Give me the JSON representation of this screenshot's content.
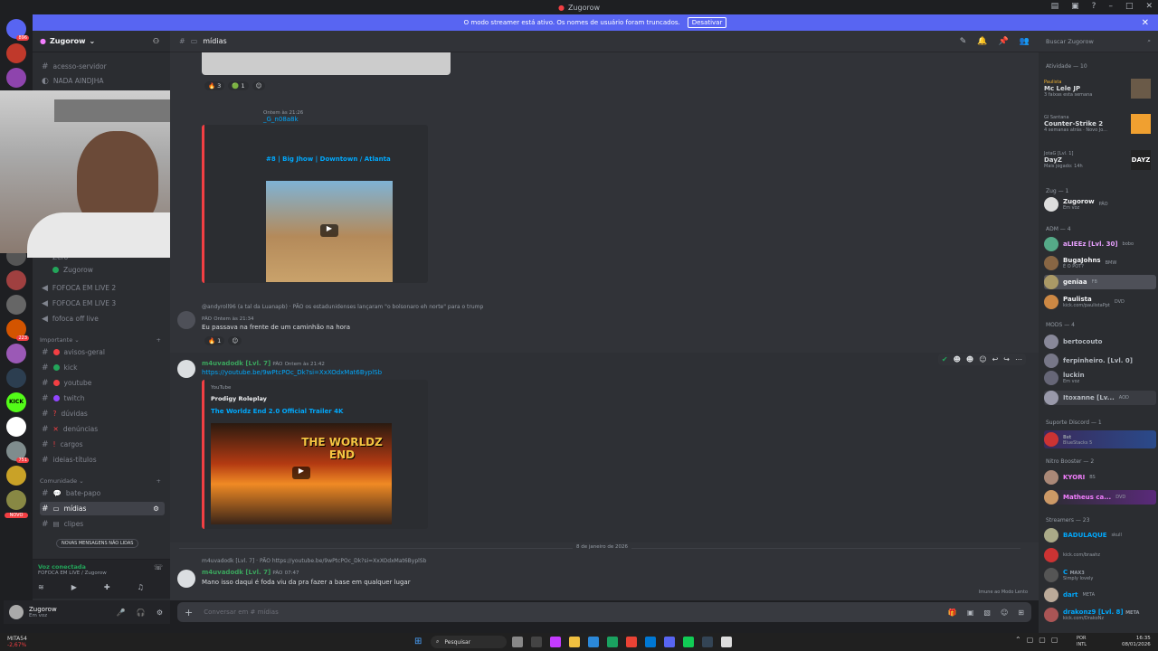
{
  "window": {
    "title": "Zugorow"
  },
  "banner": {
    "text": "O modo streamer está ativo. Os nomes de usuário foram truncados.",
    "button": "Desativar"
  },
  "server": {
    "name": "Zugorow"
  },
  "channels_top": [
    {
      "label": "acesso-servidor"
    },
    {
      "label": "NADA AINDJHA"
    }
  ],
  "voice_users": [
    {
      "label": "Zero"
    },
    {
      "label": "Zugorow"
    }
  ],
  "voice_channels": [
    {
      "label": "FOFOCA EM LIVE 2"
    },
    {
      "label": "FOFOCA EM LIVE 3"
    },
    {
      "label": "fofoca off live"
    }
  ],
  "cat_importante": "Importante",
  "channels_importante": [
    {
      "label": "avisos-geral",
      "color": "#f23f43"
    },
    {
      "label": "kick",
      "color": "#23a55a"
    },
    {
      "label": "youtube",
      "color": "#f23f43"
    },
    {
      "label": "twitch",
      "color": "#9146ff"
    },
    {
      "label": "dúvidas",
      "color": "#f23f43"
    },
    {
      "label": "denúncias",
      "color": "#f23f43"
    },
    {
      "label": "cargos",
      "color": "#f23f43"
    },
    {
      "label": "ideias-títulos",
      "color": "#80848e"
    }
  ],
  "cat_comunidade": "Comunidade",
  "channels_comunidade": [
    {
      "label": "bate-papo"
    },
    {
      "label": "mídias"
    },
    {
      "label": "clipes"
    }
  ],
  "unread_pill": "NOVAS MENSAGENS NÃO LIDAS",
  "novo": "NOVO",
  "voice_status": {
    "title": "Voz conectada",
    "sub": "FOFOCA EM LIVE / Zugorow"
  },
  "user": {
    "name": "Zugorow",
    "status": "Em voz"
  },
  "chat": {
    "channel": "mídias",
    "search": "Buscar Zugorow",
    "input_placeholder": "Conversar em # mídias"
  },
  "messages": {
    "m1_reacts": [
      "3",
      "1"
    ],
    "m2": {
      "meta": "Ontem às 21:26",
      "partial": "_G_n08a8k",
      "embed_title": "#8 | Big Jhow | Downtown / Atlanta"
    },
    "m3": {
      "reply": "@andyroll96 (a tal da Luanapb) · PÃO os estadunidenses lançaram \"o bolsonaro eh norte\" para o trump",
      "author": "PÃO",
      "time": "Ontem às 21:34",
      "text": "Eu passava na frente de um caminhão na hora",
      "react": "1"
    },
    "m4": {
      "author": "m4uvadodk [Lvl. 7]",
      "badge": "PÃO",
      "time": "Ontem às 21:42",
      "link": "https://youtube.be/9wPtcPOc_Dk?si=XxXOdxMat6ByplSb",
      "provider": "YouTube",
      "channel": "Prodigy Roleplay",
      "title": "The Worldz End 2.0 Official Trailer 4K",
      "thumb": "THE WORLDZ END"
    },
    "date_divider": "8 de janeiro de 2026",
    "m5": {
      "reply": "m4uvadodk [Lvl. 7] · PÃO https://youtube.be/9wPtcPOc_Dk?si=XxXOdxMat6ByplSb",
      "author": "m4uvadodk [Lvl. 7]",
      "badge": "PÃO",
      "time": "07:47",
      "text": "Mano isso daqui é foda viu da pra fazer a base em qualquer lugar"
    },
    "streamer_note": "Imune ao Modo Lento"
  },
  "members": {
    "activity_header": "Atividade — 10",
    "activities": [
      {
        "name": "Paulista",
        "title": "Mc Lele JP",
        "sub": "3 faixas esta semana"
      },
      {
        "name": "Gl Santana",
        "title": "Counter-Strike 2",
        "sub": "4 semanas atrás · Novo Jo..."
      },
      {
        "name": "JotaG [Lvl. 1]",
        "title": "DayZ",
        "sub": "Mais jogado: 14h"
      }
    ],
    "groups": [
      {
        "label": "Zug — 1",
        "items": [
          {
            "name": "Zugorow",
            "tag": "PÃO",
            "sub": "Em voz",
            "color": "#f2f3f5"
          }
        ]
      },
      {
        "label": "ADM — 4",
        "items": [
          {
            "name": "aLIEEz [Lvl. 30]",
            "tag": "bobo",
            "sub": "",
            "color": "#e8a0ff"
          },
          {
            "name": "BugaJohns",
            "tag": "BMW",
            "sub": "É O POT?",
            "color": "#f2f3f5"
          },
          {
            "name": "geniaa",
            "tag": "FB",
            "sub": "",
            "color": "#f2f3f5"
          },
          {
            "name": "Paulista",
            "tag": "DVD",
            "sub": "kick.com/paulistaPpt",
            "color": "#f2f3f5"
          }
        ]
      },
      {
        "label": "MODS — 4",
        "items": [
          {
            "name": "bertocouto",
            "tag": "",
            "sub": "",
            "color": "#b5bac1"
          },
          {
            "name": "ferpinheiro. [Lvl. 0]",
            "tag": "",
            "sub": "",
            "color": "#b5bac1"
          },
          {
            "name": "luckin",
            "tag": "",
            "sub": "Em voz",
            "color": "#b5bac1"
          },
          {
            "name": "Itoxanne [Lv...",
            "tag": "AOD",
            "sub": "",
            "color": "#b5bac1"
          }
        ]
      },
      {
        "label": "Suporte Discord — 1",
        "items": [
          {
            "name": "",
            "tag": "Bst",
            "sub": "BlueStacks 5",
            "color": "#f2f3f5"
          }
        ]
      },
      {
        "label": "Nitro Booster — 2",
        "items": [
          {
            "name": "KYORI",
            "tag": "BS",
            "sub": "",
            "color": "#f47fff"
          },
          {
            "name": "Matheus ca...",
            "tag": "DVD",
            "sub": "",
            "color": "#f47fff"
          }
        ]
      },
      {
        "label": "Streamers — 23",
        "items": [
          {
            "name": "BADULAQUE",
            "tag": "skull",
            "sub": "",
            "color": "#00a8fc"
          },
          {
            "name": "",
            "tag": "",
            "sub": "kick.com/braahz",
            "color": "#00a8fc"
          },
          {
            "name": "C",
            "tag": "MAX3",
            "sub": "Simply lovely",
            "color": "#00a8fc"
          },
          {
            "name": "dart",
            "tag": "META",
            "sub": "",
            "color": "#00a8fc"
          },
          {
            "name": "drakonz9 [Lvl. 8]",
            "tag": "META",
            "sub": "kick.com/DrakoNz",
            "color": "#00a8fc"
          }
        ]
      }
    ]
  },
  "taskbar": {
    "weather": "MITA54",
    "weather_sub": "-2,67%",
    "search": "Pesquisar",
    "lang": "POR",
    "lang2": "INTL",
    "time": "16:35",
    "date": "08/01/2026"
  }
}
